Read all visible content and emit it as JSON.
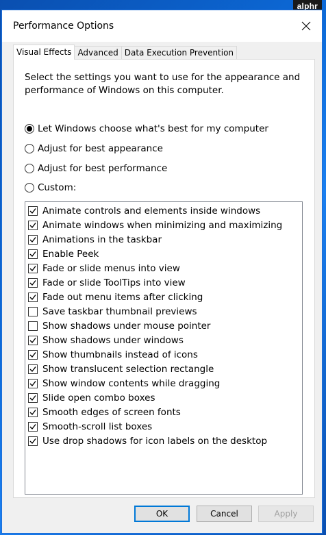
{
  "watermark": "alphr",
  "window": {
    "title": "Performance Options"
  },
  "tabs": [
    {
      "label": "Visual Effects",
      "active": true
    },
    {
      "label": "Advanced",
      "active": false
    },
    {
      "label": "Data Execution Prevention",
      "active": false
    }
  ],
  "intro": "Select the settings you want to use for the appearance and performance of Windows on this computer.",
  "radios": [
    {
      "label": "Let Windows choose what's best for my computer",
      "checked": true
    },
    {
      "label": "Adjust for best appearance",
      "checked": false
    },
    {
      "label": "Adjust for best performance",
      "checked": false
    },
    {
      "label": "Custom:",
      "checked": false
    }
  ],
  "effects": [
    {
      "label": "Animate controls and elements inside windows",
      "checked": true
    },
    {
      "label": "Animate windows when minimizing and maximizing",
      "checked": true
    },
    {
      "label": "Animations in the taskbar",
      "checked": true
    },
    {
      "label": "Enable Peek",
      "checked": true
    },
    {
      "label": "Fade or slide menus into view",
      "checked": true
    },
    {
      "label": "Fade or slide ToolTips into view",
      "checked": true
    },
    {
      "label": "Fade out menu items after clicking",
      "checked": true
    },
    {
      "label": "Save taskbar thumbnail previews",
      "checked": false
    },
    {
      "label": "Show shadows under mouse pointer",
      "checked": false
    },
    {
      "label": "Show shadows under windows",
      "checked": true
    },
    {
      "label": "Show thumbnails instead of icons",
      "checked": true
    },
    {
      "label": "Show translucent selection rectangle",
      "checked": true
    },
    {
      "label": "Show window contents while dragging",
      "checked": true
    },
    {
      "label": "Slide open combo boxes",
      "checked": true
    },
    {
      "label": "Smooth edges of screen fonts",
      "checked": true
    },
    {
      "label": "Smooth-scroll list boxes",
      "checked": true
    },
    {
      "label": "Use drop shadows for icon labels on the desktop",
      "checked": true
    }
  ],
  "buttons": {
    "ok": "OK",
    "cancel": "Cancel",
    "apply": "Apply"
  }
}
